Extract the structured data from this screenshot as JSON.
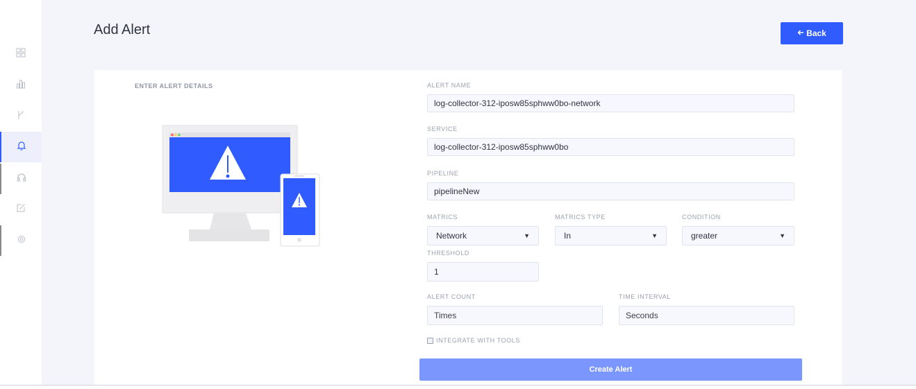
{
  "sidebar": {
    "items": [
      {
        "icon": "dashboard-grid-icon"
      },
      {
        "icon": "bar-chart-icon"
      },
      {
        "icon": "pipeline-branch-icon"
      },
      {
        "icon": "bell-icon",
        "active": true
      },
      {
        "icon": "headset-icon"
      },
      {
        "icon": "edit-icon"
      },
      {
        "icon": "settings-gear-icon"
      }
    ]
  },
  "header": {
    "title": "Add Alert",
    "back_label": "Back"
  },
  "form": {
    "section_label": "ENTER ALERT DETAILS",
    "alert_name": {
      "label": "ALERT NAME",
      "value": "log-collector-312-iposw85sphww0bo-network"
    },
    "service": {
      "label": "SERVICE",
      "value": "log-collector-312-iposw85sphww0bo"
    },
    "pipeline": {
      "label": "PIPELINE",
      "value": "pipelineNew"
    },
    "matrics": {
      "label": "MATRICS",
      "value": "Network"
    },
    "matrics_type": {
      "label": "MATRICS TYPE",
      "value": "In"
    },
    "condition": {
      "label": "CONDITION",
      "value": "greater"
    },
    "threshold": {
      "label": "THRESHOLD",
      "value": "1"
    },
    "alert_count": {
      "label": "ALERT COUNT",
      "placeholder": "Times"
    },
    "time_interval": {
      "label": "TIME INTERVAL",
      "placeholder": "Seconds"
    },
    "integrate_label": "INTEGRATE WITH TOOLS",
    "integrate_checked": false,
    "submit_label": "Create Alert"
  },
  "colors": {
    "accent": "#2f5bff",
    "submit_disabled": "#7b97fd",
    "background": "#f4f5fb"
  }
}
